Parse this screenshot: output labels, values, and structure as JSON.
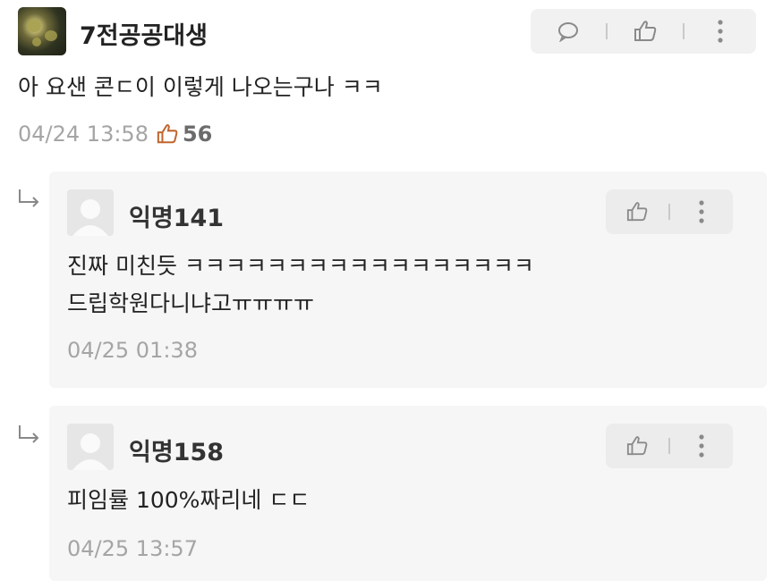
{
  "main_comment": {
    "author": "7전공공대생",
    "text": "아 요샌 콘ㄷ이 이렇게 나오는구나 ㅋㅋ",
    "date": "04/24 13:58",
    "likes": "56",
    "icons": [
      "comment-icon",
      "thumbs-up-icon",
      "more-icon"
    ]
  },
  "replies": [
    {
      "author": "익명141",
      "text_lines": [
        "진짜 미친듯 ㅋㅋㅋㅋㅋㅋㅋㅋㅋㅋㅋㅋㅋㅋㅋㅋㅋ",
        "드립학원다니냐고ㅠㅠㅠㅠ"
      ],
      "date": "04/25 01:38"
    },
    {
      "author": "익명158",
      "text_lines": [
        "피임률 100%짜리네 ㄷㄷ"
      ],
      "date": "04/25 13:57"
    }
  ],
  "colors": {
    "reply_bg": "#f6f6f6",
    "toolbar_bg": "#f1f1f1",
    "meta_text": "#a5a5a5"
  }
}
